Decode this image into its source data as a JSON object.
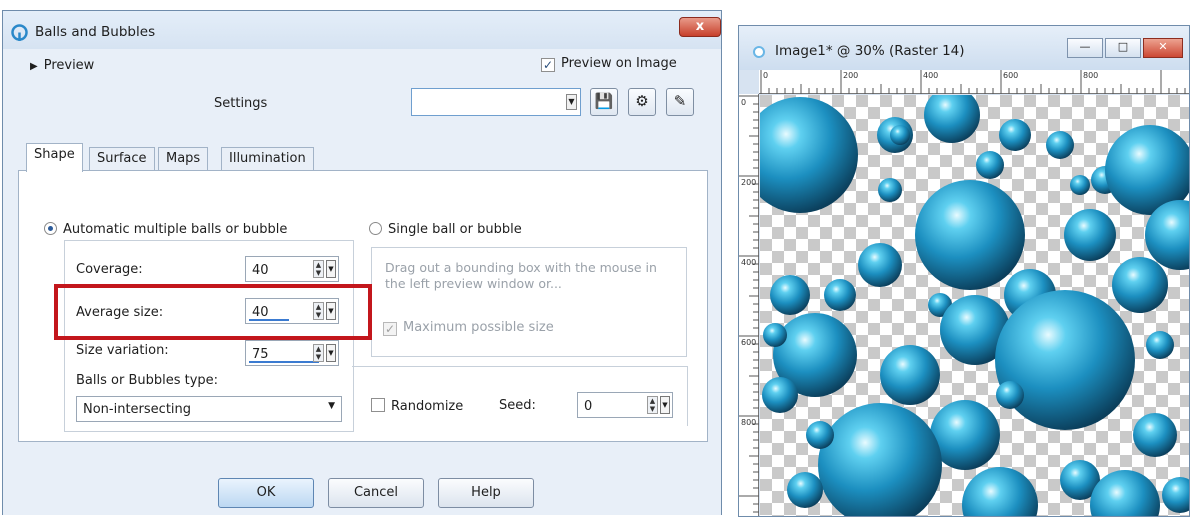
{
  "dialog": {
    "title": "Balls and Bubbles",
    "close_label": "x",
    "preview_toggle": "Preview",
    "preview_on_image": {
      "label": "Preview on Image",
      "checked": true
    },
    "settings_label": "Settings",
    "settings_value": "",
    "tabs": [
      {
        "label": "Shape",
        "active": true
      },
      {
        "label": "Surface",
        "active": false
      },
      {
        "label": "Maps",
        "active": false
      },
      {
        "label": "Illumination",
        "active": false
      }
    ],
    "mode_auto": {
      "label": "Automatic multiple balls or bubble",
      "selected": true
    },
    "mode_single": {
      "label": "Single ball or bubble",
      "selected": false
    },
    "coverage": {
      "label": "Coverage:",
      "value": "40"
    },
    "average_size": {
      "label": "Average size:",
      "value": "40"
    },
    "size_variation": {
      "label": "Size variation:",
      "value": "75"
    },
    "type": {
      "label": "Balls or Bubbles type:",
      "value": "Non-intersecting"
    },
    "hint": "Drag out a bounding box with the mouse in the left preview window or...",
    "max_size": {
      "label": "Maximum possible size",
      "checked": true,
      "enabled": false
    },
    "randomize": {
      "label": "Randomize",
      "checked": false
    },
    "seed": {
      "label": "Seed:",
      "value": "0"
    },
    "buttons": {
      "ok": "OK",
      "cancel": "Cancel",
      "help": "Help"
    },
    "highlight_color": "#c3161c"
  },
  "image_window": {
    "title": "Image1* @  30% (Raster 14)",
    "ruler_top_labels": [
      "0",
      "200",
      "400",
      "600",
      "800"
    ],
    "ruler_left_labels": [
      "0",
      "200",
      "400",
      "600",
      "800"
    ],
    "ball_color": "#1c8fc0"
  }
}
